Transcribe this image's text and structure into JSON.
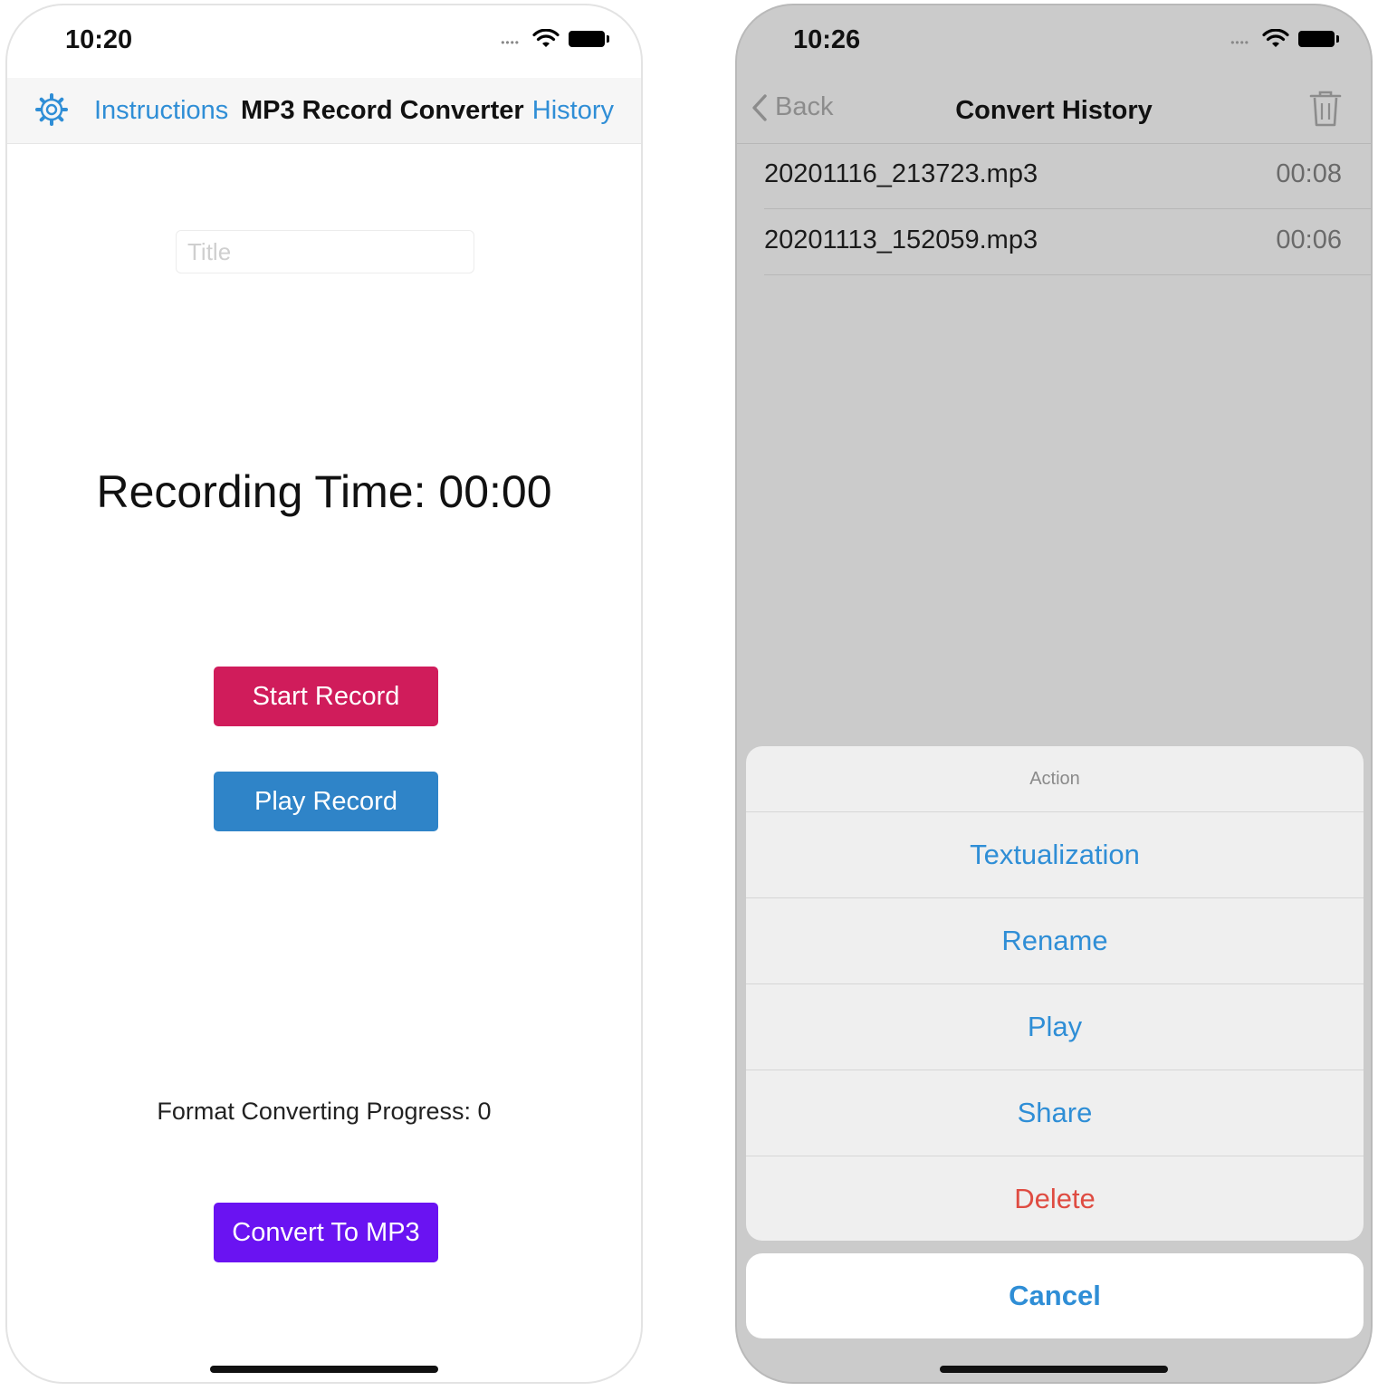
{
  "left_screen": {
    "status_time": "10:20",
    "nav": {
      "left_link": "Instructions",
      "title": "MP3 Record Converter",
      "right_link": "History"
    },
    "title_input": {
      "placeholder": "Title",
      "value": ""
    },
    "recording_time": "Recording Time: 00:00",
    "buttons": {
      "start": "Start Record",
      "play": "Play Record",
      "convert": "Convert To MP3"
    },
    "progress_text": "Format Converting Progress: 0",
    "colors": {
      "accent": "#2f8ed6",
      "start_button": "#d01c5b",
      "play_button": "#2f84c8",
      "convert_button": "#6a13f2"
    }
  },
  "right_screen": {
    "status_time": "10:26",
    "nav": {
      "back": "Back",
      "title": "Convert History"
    },
    "history": [
      {
        "name": "20201116_213723.mp3",
        "duration": "00:08"
      },
      {
        "name": "20201113_152059.mp3",
        "duration": "00:06"
      }
    ],
    "action_sheet": {
      "title": "Action",
      "items": [
        "Textualization",
        "Rename",
        "Play",
        "Share",
        "Delete"
      ],
      "cancel": "Cancel"
    },
    "colors": {
      "action_text": "#2f8ed6",
      "destructive": "#df4c42",
      "overlay": "#cbcbcb"
    }
  }
}
